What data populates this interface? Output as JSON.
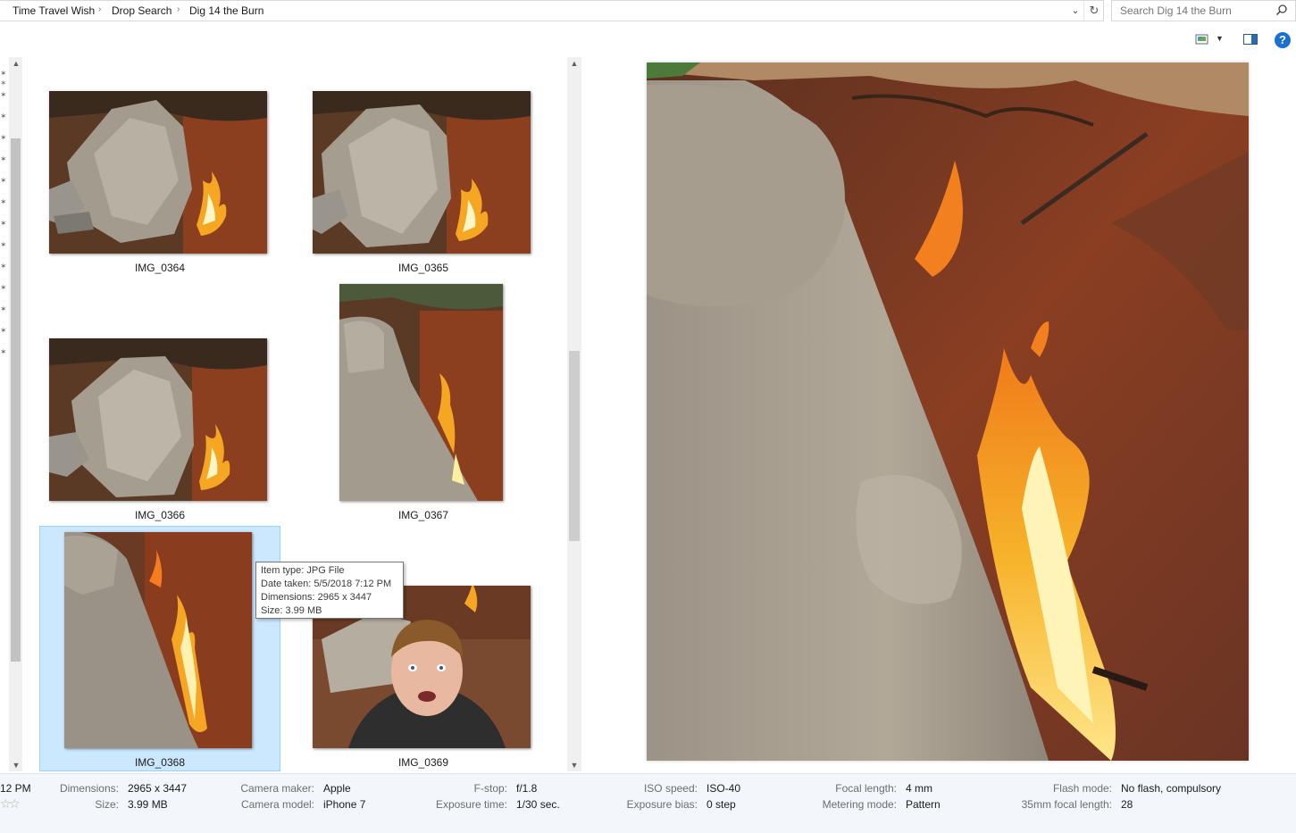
{
  "address_bar": {
    "crumbs": [
      "Time Travel Wish",
      "Drop Search",
      "Dig 14 the Burn"
    ]
  },
  "search": {
    "placeholder": "Search Dig 14 the Burn"
  },
  "toolbar": {
    "icons": [
      "change-view-icon",
      "more-options-icon",
      "preview-pane-icon",
      "help-icon"
    ],
    "help_label": "?"
  },
  "files": [
    {
      "name": "IMG_0364"
    },
    {
      "name": "IMG_0365"
    },
    {
      "name": "IMG_0366"
    },
    {
      "name": "IMG_0367"
    },
    {
      "name": "IMG_0368",
      "selected": true
    },
    {
      "name": "IMG_0369"
    }
  ],
  "tooltip": {
    "item_type": "Item type: JPG File",
    "date_taken": "Date taken: 5/5/2018 7:12 PM",
    "dimensions": "Dimensions: 2965 x 3447",
    "size": "Size: 3.99 MB"
  },
  "details": {
    "date_partial": "12 PM",
    "dimensions_label": "Dimensions:",
    "dimensions_value": "2965 x 3447",
    "size_label": "Size:",
    "size_value": "3.99 MB",
    "camera_maker_label": "Camera maker:",
    "camera_maker_value": "Apple",
    "camera_model_label": "Camera model:",
    "camera_model_value": "iPhone 7",
    "fstop_label": "F-stop:",
    "fstop_value": "f/1.8",
    "exposure_time_label": "Exposure time:",
    "exposure_time_value": "1/30 sec.",
    "iso_label": "ISO speed:",
    "iso_value": "ISO-40",
    "exposure_bias_label": "Exposure bias:",
    "exposure_bias_value": "0 step",
    "focal_length_label": "Focal length:",
    "focal_length_value": "4 mm",
    "metering_label": "Metering mode:",
    "metering_value": "Pattern",
    "flash_label": "Flash mode:",
    "flash_value": "No flash, compulsory",
    "focal35_label": "35mm focal length:",
    "focal35_value": "28"
  },
  "colors": {
    "selection": "#cce8ff",
    "selection_border": "#99d1ff",
    "help_blue": "#1b6fd1",
    "details_bg": "#f3f6fb"
  }
}
